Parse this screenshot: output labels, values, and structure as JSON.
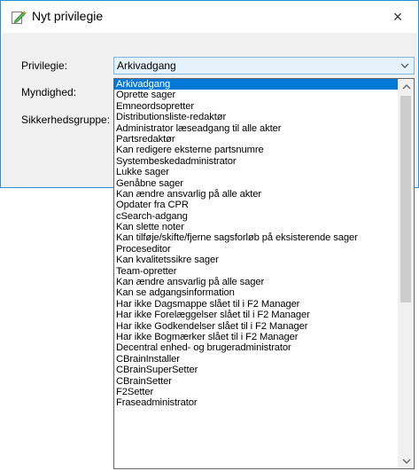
{
  "window": {
    "title": "Nyt privilegie",
    "close_label": "×"
  },
  "form": {
    "privilege_label": "Privilegie:",
    "authority_label": "Myndighed:",
    "security_group_label": "Sikkerhedsgruppe:",
    "privilege_value": "Arkivadgang"
  },
  "dropdown": {
    "selected_index": 0,
    "items": [
      "Arkivadgang",
      "Oprette sager",
      "Emneordsopretter",
      "Distributionsliste-redaktør",
      "Administrator læseadgang til alle akter",
      "Partsredaktør",
      "Kan redigere eksterne partsnumre",
      "Systembeskedadministrator",
      "Lukke sager",
      "Genåbne sager",
      "Kan ændre ansvarlig på alle akter",
      "Opdater fra CPR",
      "cSearch-adgang",
      "Kan slette noter",
      "Kan tilføje/skifte/fjerne sagsforløb på eksisterende sager",
      "Proceseditor",
      "Kan kvalitetssikre sager",
      "Team-opretter",
      "Kan ændre ansvarlig på alle sager",
      "Kan se adgangsinformation",
      "Har ikke Dagsmappe slået til i F2 Manager",
      "Har ikke Forelæggelser slået til i F2 Manager",
      "Har ikke Godkendelser slået til i F2 Manager",
      "Har ikke Bogmærker slået til i F2 Manager",
      "Decentral enhed- og brugeradministrator",
      "CBrainInstaller",
      "CBrainSuperSetter",
      "CBrainSetter",
      "F2Setter",
      "Fraseadministrator"
    ]
  },
  "icons": {
    "title_icon": "edit-document-icon",
    "combo_arrow": "chevron-down-icon",
    "scroll_up": "chevron-up-icon",
    "scroll_down": "chevron-down-icon"
  }
}
